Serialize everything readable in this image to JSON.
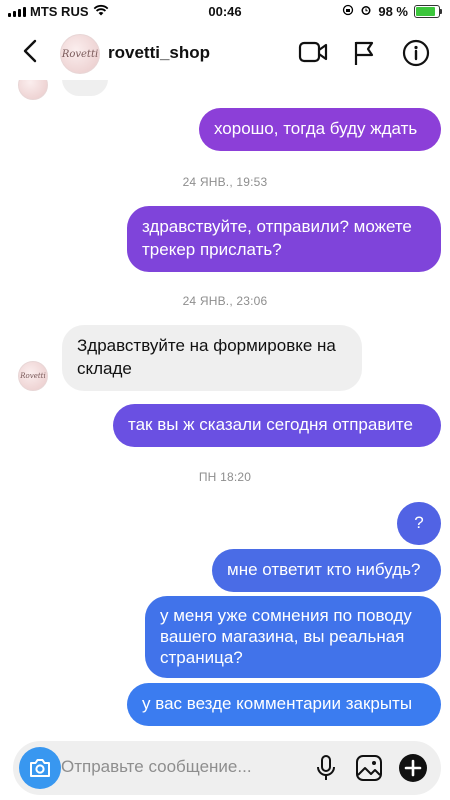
{
  "status_bar": {
    "carrier": "MTS RUS",
    "time": "00:46",
    "battery": "98 %"
  },
  "header": {
    "username": "rovetti_shop",
    "avatar_text": "Rovetti"
  },
  "messages": {
    "m1": "хорошо, тогда буду ждать",
    "ts1": "24 ЯНВ., 19:53",
    "m2": "здравствуйте, отправили? можете трекер прислать?",
    "ts2": "24 ЯНВ., 23:06",
    "m3": "Здравствуйте на формировке на складе",
    "m4": "так вы ж сказали сегодня отправите",
    "ts3": "ПН 18:20",
    "m5": "?",
    "m6": "мне ответит кто нибудь?",
    "m7": "у меня уже сомнения по поводу вашего магазина, вы реальная страница?",
    "m8": "у вас везде комментарии закрыты"
  },
  "composer": {
    "placeholder": "Отправьте сообщение..."
  },
  "icons": {
    "back": "chevron-left-icon",
    "video": "video-camera-icon",
    "flag": "flag-icon",
    "info": "info-icon",
    "camera": "camera-icon",
    "mic": "microphone-icon",
    "gallery": "image-icon",
    "plus": "plus-circle-icon"
  },
  "colors": {
    "bubble_purple": "#8c3fd8",
    "bubble_violet": "#6f4ee0",
    "bubble_blue": "#4b6fe6",
    "bubble_lightblue": "#3b7cf0",
    "incoming_bubble": "#efefef",
    "camera_button": "#3897f0"
  }
}
